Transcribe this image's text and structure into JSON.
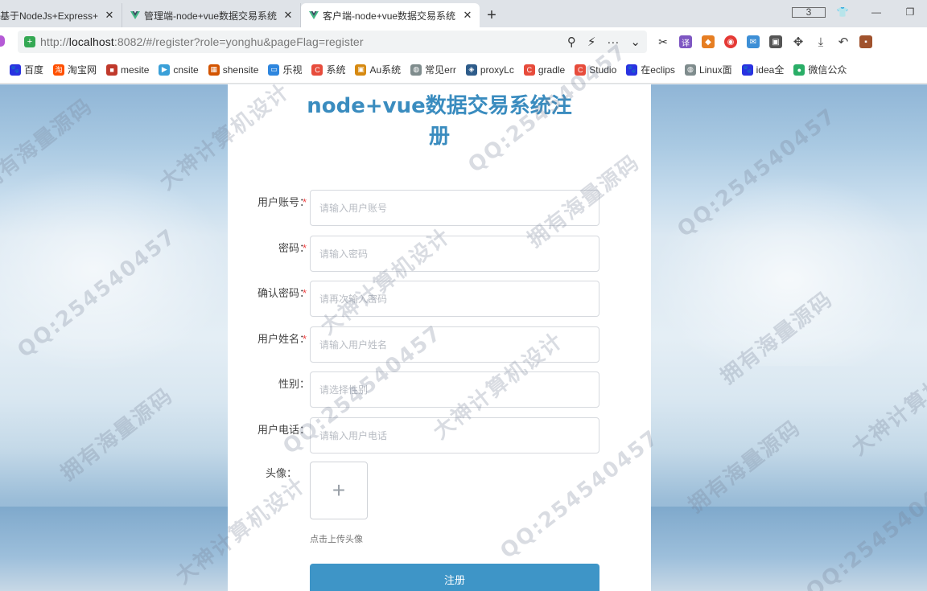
{
  "browser": {
    "tabs": [
      {
        "title": "基于NodeJs+Express+",
        "active": false
      },
      {
        "title": "管理端-node+vue数据交易系统",
        "active": false
      },
      {
        "title": "客户端-node+vue数据交易系统",
        "active": true
      }
    ],
    "tab_count": "3",
    "address": {
      "prefix": "http://",
      "host": "localhost",
      "rest": ":8082/#/register?role=yonghu&pageFlag=register"
    },
    "bookmarks": [
      {
        "label": "百度",
        "icon": "paw-icon",
        "color": "#2932e1"
      },
      {
        "label": "淘宝网",
        "icon": "taobao-icon",
        "color": "#ff5000"
      },
      {
        "label": "mesite",
        "icon": "mesite-icon",
        "color": "#c0392b"
      },
      {
        "label": "cnsite",
        "icon": "cnsite-icon",
        "color": "#3aa0d8"
      },
      {
        "label": "shensite",
        "icon": "grid-icon",
        "color": "#d35400"
      },
      {
        "label": "乐视",
        "icon": "tv-icon",
        "color": "#2e86de"
      },
      {
        "label": "系统",
        "icon": "c-icon",
        "color": "#e74c3c"
      },
      {
        "label": "Au系统",
        "icon": "box-icon",
        "color": "#d68910"
      },
      {
        "label": "常见err",
        "icon": "globe-icon",
        "color": "#7f8c8d"
      },
      {
        "label": "proxyLc",
        "icon": "python-icon",
        "color": "#2e5c8a"
      },
      {
        "label": "gradle",
        "icon": "c-icon",
        "color": "#e74c3c"
      },
      {
        "label": "Studio",
        "icon": "c-icon",
        "color": "#e74c3c"
      },
      {
        "label": "在eclips",
        "icon": "paw-icon",
        "color": "#2932e1"
      },
      {
        "label": "Linux面",
        "icon": "globe-icon",
        "color": "#7f8c8d"
      },
      {
        "label": "idea全",
        "icon": "paw-icon",
        "color": "#2932e1"
      },
      {
        "label": "微信公众",
        "icon": "wechat-icon",
        "color": "#2aae67"
      }
    ]
  },
  "register": {
    "title": "node+vue数据交易系统注册",
    "fields": [
      {
        "label": "用户账号：",
        "placeholder": "请输入用户账号",
        "required": true
      },
      {
        "label": "密码：",
        "placeholder": "请输入密码",
        "required": true
      },
      {
        "label": "确认密码：",
        "placeholder": "请再次输入密码",
        "required": true
      },
      {
        "label": "用户姓名：",
        "placeholder": "请输入用户姓名",
        "required": true
      },
      {
        "label": "性别：",
        "placeholder": "请选择性别",
        "required": false
      },
      {
        "label": "用户电话：",
        "placeholder": "请输入用户电话",
        "required": false
      }
    ],
    "avatar": {
      "label": "头像：",
      "hint": "点击上传头像"
    },
    "submit_label": "注册",
    "required_mark": "*"
  },
  "watermarks": [
    "大神计算机设计",
    "QQ:254540457",
    "拥有海量源码"
  ]
}
